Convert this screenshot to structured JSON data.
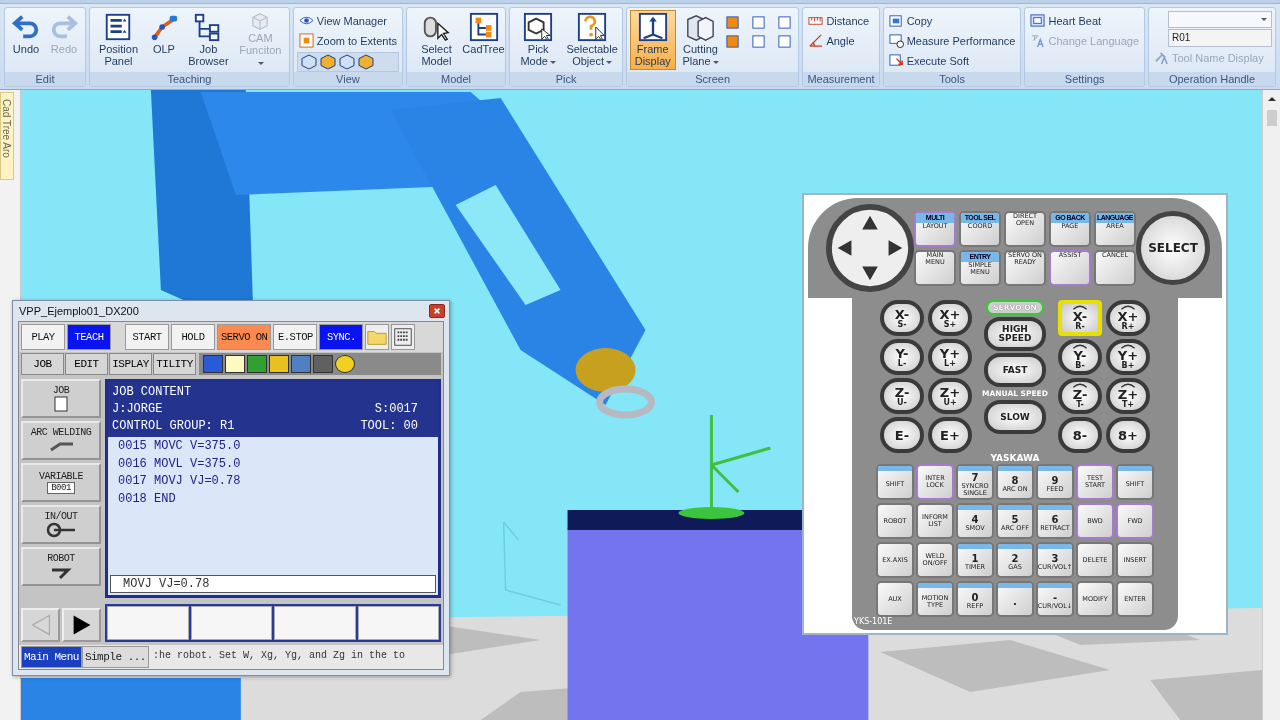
{
  "ribbon": {
    "groups": [
      {
        "label": "Edit",
        "items": [
          {
            "kind": "large",
            "label": "Undo",
            "disabled": false,
            "pressed": false
          },
          {
            "kind": "large",
            "label": "Redo",
            "disabled": true,
            "pressed": false
          }
        ]
      },
      {
        "label": "Teaching",
        "items": [
          {
            "kind": "large",
            "label": "Position Panel",
            "disabled": false,
            "pressed": false
          },
          {
            "kind": "large",
            "label": "OLP",
            "disabled": false,
            "pressed": false
          },
          {
            "kind": "large",
            "label": "Job Browser",
            "disabled": false,
            "pressed": false
          },
          {
            "kind": "large",
            "label": "CAM Funciton",
            "disabled": true,
            "pressed": false,
            "dropdown": true
          }
        ]
      },
      {
        "label": "View",
        "items": [
          {
            "kind": "small",
            "label": "View Manager",
            "disabled": false
          },
          {
            "kind": "small",
            "label": "Zoom to Extents",
            "disabled": false
          },
          {
            "kind": "view-cubes"
          }
        ]
      },
      {
        "label": "Model",
        "items": [
          {
            "kind": "large",
            "label": "Select Model",
            "disabled": false,
            "pressed": false
          },
          {
            "kind": "large",
            "label": "CadTree",
            "disabled": false,
            "pressed": false
          }
        ]
      },
      {
        "label": "Pick",
        "items": [
          {
            "kind": "large",
            "label": "Pick Mode",
            "disabled": false,
            "pressed": false,
            "dropdown": true
          },
          {
            "kind": "large",
            "label": "Selectable Object",
            "disabled": false,
            "pressed": false,
            "dropdown": true
          }
        ]
      },
      {
        "label": "Screen",
        "items": [
          {
            "kind": "large",
            "label": "Frame Display",
            "disabled": false,
            "pressed": true
          },
          {
            "kind": "large",
            "label": "Cutting Plane",
            "disabled": false,
            "pressed": false,
            "dropdown": true
          },
          {
            "kind": "screen-icons"
          }
        ]
      },
      {
        "label": "Measurement",
        "items": [
          {
            "kind": "small",
            "label": "Distance",
            "disabled": false
          },
          {
            "kind": "small",
            "label": "Angle",
            "disabled": false
          }
        ]
      },
      {
        "label": "Tools",
        "items": [
          {
            "kind": "small",
            "label": "Copy",
            "disabled": false
          },
          {
            "kind": "small",
            "label": "Measure Performance",
            "disabled": false
          },
          {
            "kind": "small",
            "label": "Execute Soft",
            "disabled": false
          }
        ]
      },
      {
        "label": "Settings",
        "items": [
          {
            "kind": "small",
            "label": "Heart Beat",
            "disabled": false
          },
          {
            "kind": "small",
            "label": "Change Language",
            "disabled": true
          }
        ]
      },
      {
        "label": "Operation Handle",
        "items": [
          {
            "kind": "combo"
          },
          {
            "kind": "field",
            "value": "R01"
          },
          {
            "kind": "small",
            "label": "Tool Name Display",
            "disabled": true
          }
        ]
      }
    ]
  },
  "side_tab": "Cad Tree Aro",
  "pendant": {
    "title": "VPP_Ejemplo01_DX200",
    "top_buttons": [
      {
        "label": "PLAY",
        "kind": "plain"
      },
      {
        "label": "TEACH",
        "kind": "blue"
      },
      {
        "label": "START",
        "kind": "plain"
      },
      {
        "label": "HOLD",
        "kind": "plain"
      },
      {
        "label": "SERVO ON",
        "kind": "orange"
      },
      {
        "label": "E.STOP",
        "kind": "plain"
      },
      {
        "label": "SYNC.",
        "kind": "blue"
      }
    ],
    "menu_tabs": [
      "JOB",
      "EDIT",
      "ISPLAY",
      "TILITY"
    ],
    "side_menu": [
      {
        "label": "JOB"
      },
      {
        "label": "ARC WELDING"
      },
      {
        "label": "VARIABLE",
        "sub": "B001"
      },
      {
        "label": "IN/OUT"
      },
      {
        "label": "ROBOT"
      }
    ],
    "job": {
      "title": "JOB CONTENT",
      "name": "J:JORGE",
      "step": "S:0017",
      "group": "CONTROL GROUP: R1",
      "tool": "TOOL: 00",
      "lines": [
        "0015 MOVC V=375.0",
        "0016 MOVL V=375.0",
        "0017 MOVJ VJ=0.78",
        "0018 END"
      ]
    },
    "input_line": "MOVJ VJ=0.78",
    "bottom_tabs": [
      {
        "label": "Main Menu",
        "selected": true
      },
      {
        "label": "Simple ...",
        "selected": false
      }
    ],
    "message": ":he robot. Set W, Xg, Yg, and Zg in the to"
  },
  "keypad": {
    "upper_keys": [
      {
        "top": "MULTI",
        "label": "LAYOUT",
        "kind": "purple"
      },
      {
        "top": "TOOL SEL",
        "label": "COORD",
        "kind": "blue"
      },
      {
        "label": "DIRECT OPEN",
        "kind": "plain"
      },
      {
        "top": "GO BACK",
        "label": "PAGE",
        "kind": "blue"
      },
      {
        "top": "LANGUAGE",
        "label": "AREA",
        "kind": "blue"
      },
      {
        "label": "MAIN MENU",
        "kind": "plain"
      },
      {
        "top": "ENTRY",
        "label": "SIMPLE MENU",
        "kind": "blue"
      },
      {
        "label": "SERVO ON READY",
        "kind": "plain"
      },
      {
        "label": "ASSIST",
        "kind": "purple"
      },
      {
        "label": "CANCEL",
        "kind": "plain"
      }
    ],
    "select": "SELECT",
    "servo_lamp": "SERVO ON",
    "jog_left": [
      {
        "axis": "X-",
        "sub": "S-"
      },
      {
        "axis": "X+",
        "sub": "S+"
      },
      {
        "axis": "Y-",
        "sub": "L-"
      },
      {
        "axis": "Y+",
        "sub": "L+"
      },
      {
        "axis": "Z-",
        "sub": "U-"
      },
      {
        "axis": "Z+",
        "sub": "U+"
      },
      {
        "axis": "E-"
      },
      {
        "axis": "E+"
      }
    ],
    "speed": {
      "high": "HIGH SPEED",
      "fast": "FAST",
      "caption": "MANUAL SPEED",
      "slow": "SLOW"
    },
    "jog_right": [
      {
        "axis": "X-",
        "sub": "R-",
        "hover": true
      },
      {
        "axis": "X+",
        "sub": "R+",
        "hover": false
      },
      {
        "axis": "Y-",
        "sub": "B-",
        "hover": false
      },
      {
        "axis": "Y+",
        "sub": "B+",
        "hover": false
      },
      {
        "axis": "Z-",
        "sub": "T-",
        "hover": false
      },
      {
        "axis": "Z+",
        "sub": "T+",
        "hover": false
      },
      {
        "axis": "8-",
        "hover": false
      },
      {
        "axis": "8+",
        "hover": false
      }
    ],
    "brand": "YASKAWA",
    "grid_keys": [
      {
        "label": "SHIFT",
        "kind": "blue"
      },
      {
        "label": "INTER LOCK",
        "kind": "purple"
      },
      {
        "num": "7",
        "label": "SYNCRO SINGLE",
        "kind": "blue"
      },
      {
        "num": "8",
        "label": "ARC ON",
        "kind": "blue"
      },
      {
        "num": "9",
        "label": "FEED",
        "kind": "blue"
      },
      {
        "label": "TEST START",
        "kind": "purple"
      },
      {
        "label": "SHIFT",
        "kind": "blue"
      },
      {
        "label": "ROBOT",
        "kind": "plain"
      },
      {
        "label": "INFORM LIST",
        "kind": "plain"
      },
      {
        "num": "4",
        "label": "SMOV",
        "kind": "blue"
      },
      {
        "num": "5",
        "label": "ARC OFF",
        "kind": "blue"
      },
      {
        "num": "6",
        "label": "RETRACT",
        "kind": "blue"
      },
      {
        "label": "BWD",
        "kind": "purple"
      },
      {
        "label": "FWD",
        "kind": "purple"
      },
      {
        "label": "EX.AXIS",
        "kind": "plain"
      },
      {
        "label": "WELD ON/OFF",
        "kind": "plain"
      },
      {
        "num": "1",
        "label": "TIMER",
        "kind": "blue"
      },
      {
        "num": "2",
        "label": "GAS",
        "kind": "blue"
      },
      {
        "num": "3",
        "label": "CUR/VOL↑",
        "kind": "blue"
      },
      {
        "label": "DELETE",
        "kind": "plain"
      },
      {
        "label": "INSERT",
        "kind": "plain"
      },
      {
        "label": "AUX",
        "kind": "plain"
      },
      {
        "label": "MOTION TYPE",
        "kind": "blue"
      },
      {
        "num": "0",
        "label": "REFP",
        "kind": "blue"
      },
      {
        "num": ".",
        "kind": "blue"
      },
      {
        "num": "-",
        "label": "CUR/VOL↓",
        "kind": "blue"
      },
      {
        "label": "MODIFY",
        "kind": "plain"
      },
      {
        "label": "ENTER",
        "kind": "plain"
      }
    ],
    "model": "YKS-101E"
  }
}
